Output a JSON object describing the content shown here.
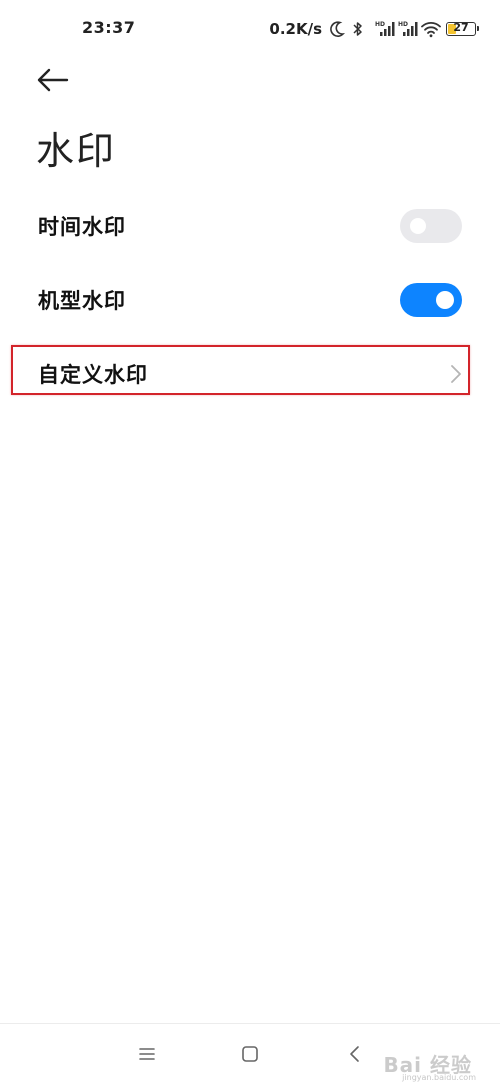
{
  "status_bar": {
    "time": "23:37",
    "net_speed": "0.2K/s",
    "battery_level": "27",
    "battery_fraction": 0.27,
    "icons": [
      "moon-icon",
      "bluetooth-icon",
      "hd-signal-icon",
      "hd-signal-icon",
      "wifi-icon",
      "battery-icon"
    ]
  },
  "header": {
    "back_icon": "back-arrow-icon",
    "title": "水印"
  },
  "settings": {
    "time_watermark": {
      "label": "时间水印",
      "enabled": false
    },
    "model_watermark": {
      "label": "机型水印",
      "enabled": true
    },
    "custom_watermark": {
      "label": "自定义水印",
      "chevron_icon": "chevron-right-icon"
    }
  },
  "colors": {
    "accent": "#0d84ff",
    "toggle_off": "#e9e9ec",
    "highlight": "#d3242a"
  },
  "nav_bar": {
    "icons": [
      "menu-icon",
      "home-icon",
      "back-icon"
    ]
  },
  "watermark": {
    "text": "Bai 经验",
    "sub": "jingyan.baidu.com"
  }
}
